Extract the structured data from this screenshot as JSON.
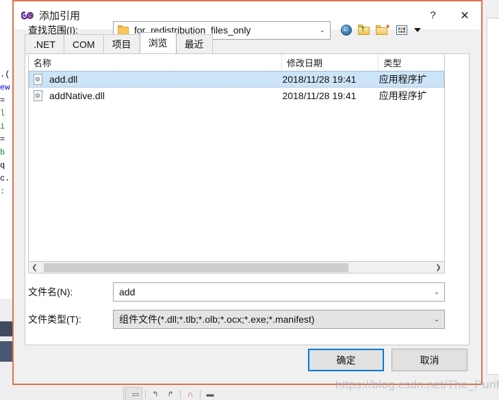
{
  "background": {
    "code_lines": [
      ".(",
      "",
      "ew",
      "=",
      "",
      "l",
      "i",
      "=",
      "b",
      "q",
      "c.",
      ":"
    ],
    "watermark": "https://blog.csdn.net/The_Purifier",
    "toolbar_icons": [
      "save-icon",
      "undo-icon",
      "redo-icon",
      "stop-icon",
      "minus-icon"
    ]
  },
  "dialog": {
    "title": "添加引用",
    "title_icon": "visual-studio-infinity-icon",
    "help_label": "?",
    "close_label": "✕",
    "tabs": [
      {
        "label": ".NET",
        "active": false
      },
      {
        "label": "COM",
        "active": false
      },
      {
        "label": "项目",
        "active": false
      },
      {
        "label": "浏览",
        "active": true
      },
      {
        "label": "最近",
        "active": false
      }
    ],
    "lookin": {
      "label": "查找范围(I):",
      "value": "for_redistribution_files_only",
      "folder_icon": "folder-icon",
      "dropdown_icon": "chevron-down-icon",
      "nav_buttons": [
        {
          "name": "back-button",
          "icon": "back-arrow-icon"
        },
        {
          "name": "up-one-level-button",
          "icon": "folder-up-icon"
        },
        {
          "name": "new-folder-button",
          "icon": "new-folder-icon"
        },
        {
          "name": "views-button",
          "icon": "views-grid-icon"
        }
      ]
    },
    "filelist": {
      "columns": [
        {
          "key": "name",
          "label": "名称",
          "sorted": true,
          "sort_icon": "caret-up-icon"
        },
        {
          "key": "date",
          "label": "修改日期",
          "sorted": false
        },
        {
          "key": "type",
          "label": "类型",
          "sorted": false
        }
      ],
      "rows": [
        {
          "name": "add.dll",
          "date": "2018/11/28 19:41",
          "type": "应用程序扩",
          "icon": "dll-file-icon",
          "selected": true
        },
        {
          "name": "addNative.dll",
          "date": "2018/11/28 19:41",
          "type": "应用程序扩",
          "icon": "dll-file-icon",
          "selected": false
        }
      ],
      "scrollbar": {
        "left_icon": "chevron-left-icon",
        "right_icon": "chevron-right-icon"
      }
    },
    "filename": {
      "label": "文件名(N):",
      "value": "add",
      "dropdown_icon": "chevron-down-icon"
    },
    "filetype": {
      "label": "文件类型(T):",
      "value": "组件文件(*.dll;*.tlb;*.olb;*.ocx;*.exe;*.manifest)",
      "dropdown_icon": "chevron-down-icon"
    },
    "buttons": {
      "ok": "确定",
      "cancel": "取消"
    }
  },
  "colors": {
    "dialog_border": "#e0704a",
    "accent": "#0078d7",
    "selection": "#cce4f7"
  }
}
